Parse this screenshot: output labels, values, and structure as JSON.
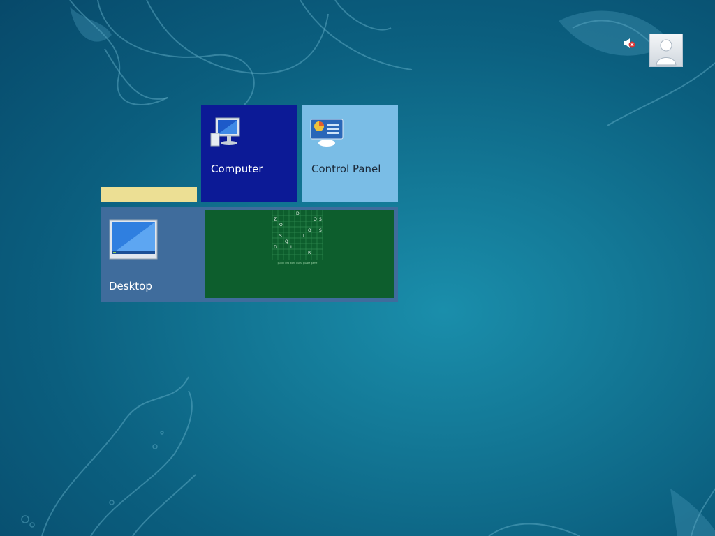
{
  "user": {
    "username": "",
    "status_icon": "speaker-muted-icon",
    "avatar_icon": "user-avatar-icon"
  },
  "tiles": {
    "computer": {
      "label": "Computer",
      "icon": "monitor-computer-icon",
      "color": "#0c1a96"
    },
    "control_panel": {
      "label": "Control Panel",
      "icon": "control-panel-icon",
      "color": "#7abde6"
    },
    "desktop": {
      "label": "Desktop",
      "icon": "desktop-monitor-icon",
      "color": "#3f6c9c"
    },
    "partial": {
      "label": "",
      "color": "#ecdf94"
    },
    "puzzle": {
      "color": "#0d5e2d",
      "letters": [
        "D",
        "Z",
        "Q",
        "S",
        "O",
        "O",
        "S",
        "S",
        "T",
        "Q",
        "D",
        "L",
        "R"
      ],
      "caption": "public info word quest puzzle game"
    }
  },
  "colors": {
    "background_center": "#1a8eab",
    "background_edge": "#07496a"
  }
}
